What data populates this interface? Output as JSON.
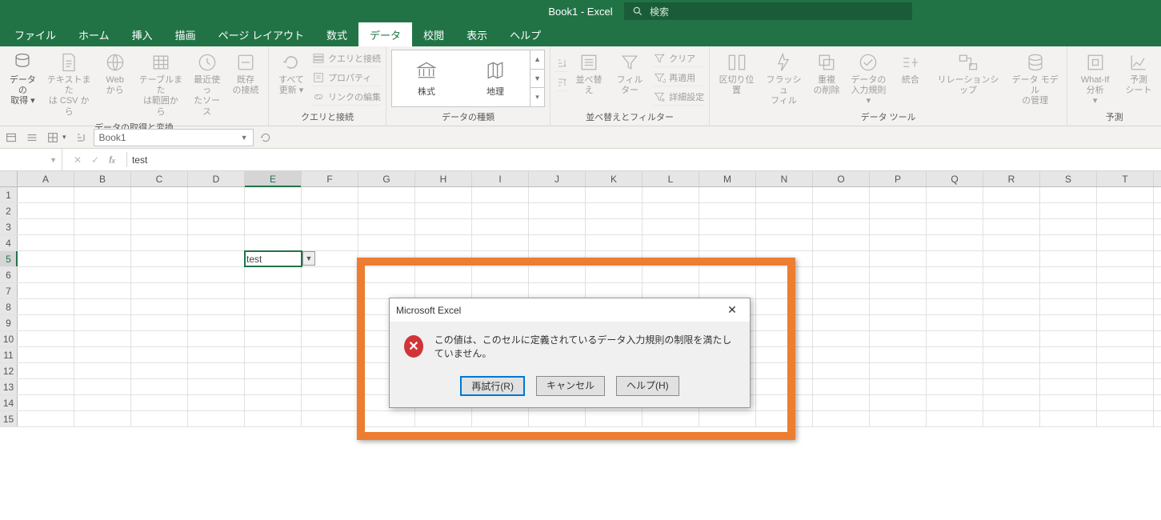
{
  "titlebar": {
    "doc_title": "Book1  -  Excel",
    "search_placeholder": "検索"
  },
  "tabs": [
    "ファイル",
    "ホーム",
    "挿入",
    "描画",
    "ページ レイアウト",
    "数式",
    "データ",
    "校閲",
    "表示",
    "ヘルプ"
  ],
  "active_tab_index": 6,
  "ribbon": {
    "groups": {
      "get_transform": {
        "label": "データの取得と変換",
        "btns": {
          "get_data": "データの\n取得 ▾",
          "from_csv": "テキストまた\nは CSV から",
          "from_web": "Web\nから",
          "from_table": "テーブルまた\nは範囲から",
          "recent": "最近使っ\nたソース",
          "existing_conn": "既存\nの接続"
        }
      },
      "queries": {
        "label": "クエリと接続",
        "refresh": "すべて\n更新 ▾",
        "rows": {
          "queries_conn": "クエリと接続",
          "properties": "プロパティ",
          "edit_links": "リンクの編集"
        }
      },
      "data_types": {
        "label": "データの種類",
        "items": [
          "株式",
          "地理"
        ]
      },
      "sort_filter": {
        "label": "並べ替えとフィルター",
        "sort": "並べ替え",
        "filter": "フィルター",
        "rows": {
          "clear": "クリア",
          "reapply": "再適用",
          "advanced": "詳細設定"
        }
      },
      "data_tools": {
        "label": "データ ツール",
        "btns": {
          "text_to_cols": "区切り位置",
          "flash_fill": "フラッシュ\nフィル",
          "remove_dupes": "重複\nの削除",
          "data_validation": "データの\n入力規則 ▾",
          "consolidate": "統合",
          "relationships": "リレーションシップ",
          "data_model": "データ モデル\nの管理"
        }
      },
      "forecast": {
        "label": "予測",
        "btns": {
          "whatif": "What-If 分析\n▾",
          "forecast_sheet": "予測\nシート"
        }
      }
    }
  },
  "secrow": {
    "book_name": "Book1"
  },
  "formula_bar": {
    "name": "",
    "value": "test"
  },
  "columns": [
    "A",
    "B",
    "C",
    "D",
    "E",
    "F",
    "G",
    "H",
    "I",
    "J",
    "K",
    "L",
    "M",
    "N",
    "O",
    "P",
    "Q",
    "R",
    "S",
    "T"
  ],
  "active_col_index": 4,
  "row_count": 15,
  "active_row": 5,
  "active_cell_value": "test",
  "dialog": {
    "title": "Microsoft Excel",
    "message": "この値は、このセルに定義されているデータ入力規則の制限を満たしていません。",
    "buttons": {
      "retry": "再試行(R)",
      "cancel": "キャンセル",
      "help": "ヘルプ(H)"
    }
  }
}
